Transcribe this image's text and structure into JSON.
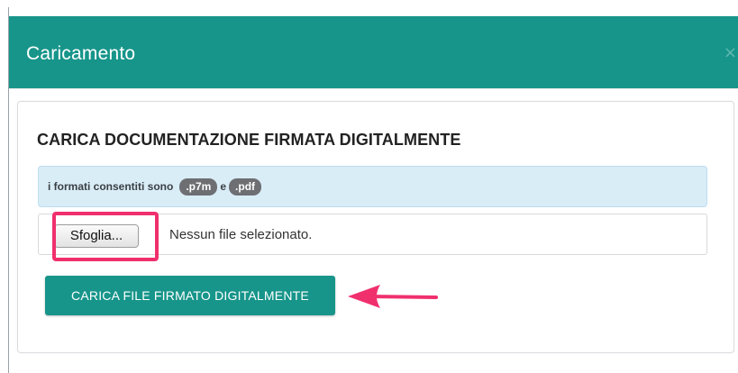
{
  "modal": {
    "title": "Caricamento",
    "close_glyph": "×"
  },
  "panel": {
    "title": "CARICA DOCUMENTAZIONE FIRMATA DIGITALMENTE",
    "info_text": "i formati consentiti sono",
    "format_1": ".p7m",
    "info_join": "e",
    "format_2": ".pdf"
  },
  "file_input": {
    "browse_label": "Sfoglia...",
    "status_text": "Nessun file selezionato."
  },
  "actions": {
    "upload_label": "CARICA FILE FIRMATO DIGITALMENTE"
  },
  "colors": {
    "accent": "#17958a",
    "info_bg": "#d9edf7",
    "badge_bg": "#6d6f72",
    "annotation": "#f0306d"
  }
}
